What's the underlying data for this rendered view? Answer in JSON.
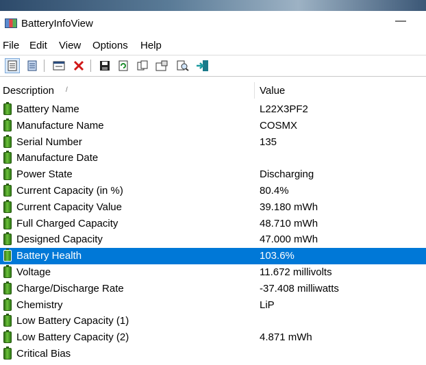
{
  "window": {
    "title": "BatteryInfoView",
    "minimize": "—"
  },
  "menu": [
    "File",
    "Edit",
    "View",
    "Options",
    "Help"
  ],
  "toolbar": [
    {
      "name": "properties-view-icon",
      "glyph": "▤"
    },
    {
      "name": "html-view-icon",
      "glyph": "▦"
    },
    {
      "name": "log-window-icon",
      "glyph": "▭"
    },
    {
      "name": "clear-icon",
      "glyph": "✕"
    },
    {
      "name": "save-icon",
      "glyph": "💾"
    },
    {
      "name": "refresh-icon",
      "glyph": "⟳"
    },
    {
      "name": "copy-icon",
      "glyph": "⎘"
    },
    {
      "name": "properties-icon",
      "glyph": "🗔"
    },
    {
      "name": "find-icon",
      "glyph": "🔍"
    },
    {
      "name": "exit-icon",
      "glyph": "⇥"
    }
  ],
  "columns": {
    "description": "Description",
    "value": "Value"
  },
  "rows": [
    {
      "desc": "Battery Name",
      "value": "L22X3PF2"
    },
    {
      "desc": "Manufacture Name",
      "value": "COSMX"
    },
    {
      "desc": "Serial Number",
      "value": "  135"
    },
    {
      "desc": "Manufacture Date",
      "value": ""
    },
    {
      "desc": "Power State",
      "value": "Discharging"
    },
    {
      "desc": "Current Capacity (in %)",
      "value": "80.4%"
    },
    {
      "desc": "Current Capacity Value",
      "value": "39.180 mWh"
    },
    {
      "desc": "Full Charged Capacity",
      "value": "48.710 mWh"
    },
    {
      "desc": "Designed Capacity",
      "value": "47.000 mWh"
    },
    {
      "desc": "Battery Health",
      "value": "103.6%",
      "selected": true
    },
    {
      "desc": "Voltage",
      "value": "11.672 millivolts"
    },
    {
      "desc": "Charge/Discharge Rate",
      "value": "-37.408 milliwatts"
    },
    {
      "desc": "Chemistry",
      "value": "LiP"
    },
    {
      "desc": "Low Battery Capacity (1)",
      "value": ""
    },
    {
      "desc": "Low Battery Capacity (2)",
      "value": "4.871 mWh"
    },
    {
      "desc": "Critical Bias",
      "value": ""
    }
  ],
  "colors": {
    "selection": "#0078d7",
    "battery": "#4aa52a"
  }
}
